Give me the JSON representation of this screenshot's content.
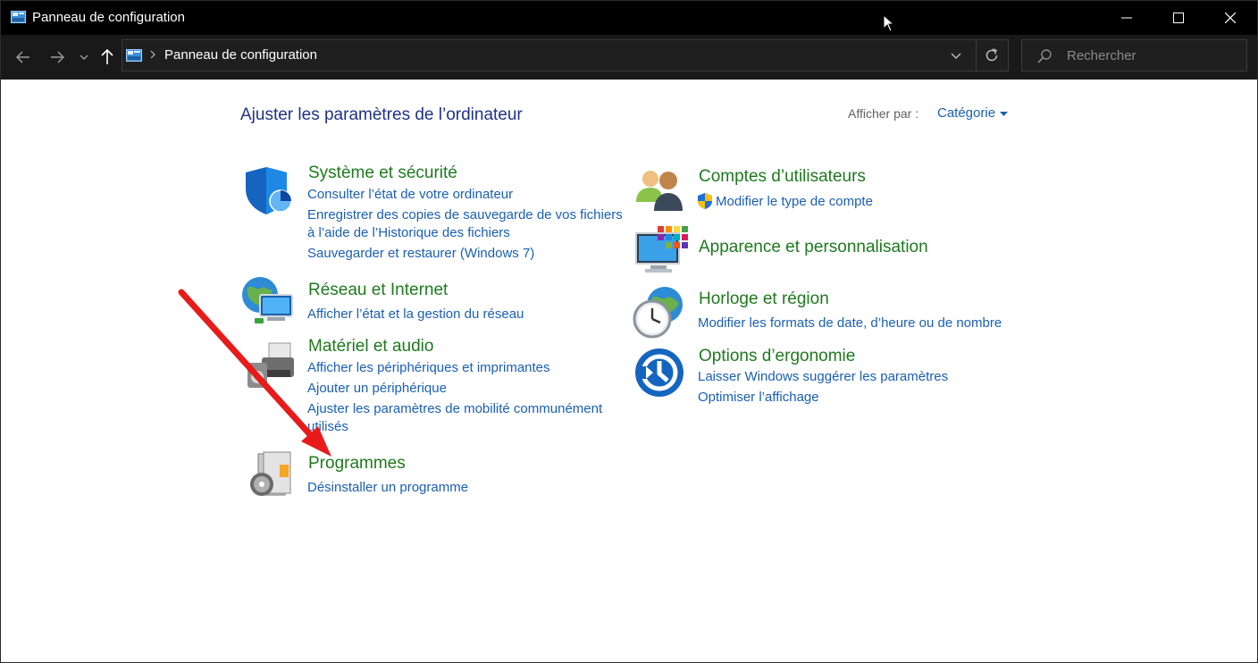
{
  "window": {
    "title": "Panneau de configuration"
  },
  "address": {
    "path": "Panneau de configuration",
    "search_placeholder": "Rechercher"
  },
  "main": {
    "heading": "Ajuster les paramètres de l’ordinateur",
    "view_by_label": "Afficher par :",
    "view_by_value": "Catégorie"
  },
  "categories": {
    "system": {
      "title": "Système et sécurité",
      "links": [
        "Consulter l’état de votre ordinateur",
        "Enregistrer des copies de sauvegarde de vos fichiers",
        "à l’aide de l’Historique des fichiers",
        "Sauvegarder et restaurer (Windows 7)"
      ]
    },
    "network": {
      "title": "Réseau et Internet",
      "links": [
        "Afficher l’état et la gestion du réseau"
      ]
    },
    "hardware": {
      "title": "Matériel et audio",
      "links": [
        "Afficher les périphériques et imprimantes",
        "Ajouter un périphérique",
        "Ajuster les paramètres de mobilité communément",
        "utilisés"
      ]
    },
    "programs": {
      "title": "Programmes",
      "links": [
        "Désinstaller un programme"
      ]
    },
    "accounts": {
      "title": "Comptes d’utilisateurs",
      "links": [
        "Modifier le type de compte"
      ]
    },
    "appearance": {
      "title": "Apparence et personnalisation"
    },
    "clock": {
      "title": "Horloge et région",
      "links": [
        "Modifier les formats de date, d’heure ou de nombre"
      ]
    },
    "ease": {
      "title": "Options d’ergonomie",
      "links": [
        "Laisser Windows suggérer les paramètres",
        "Optimiser l’affichage"
      ]
    }
  },
  "colors": {
    "title_bar": "#000000",
    "category_title": "#1e7a1e",
    "link": "#1a5fb4",
    "heading": "#1e3287",
    "annotation_arrow": "#e81b1b"
  }
}
